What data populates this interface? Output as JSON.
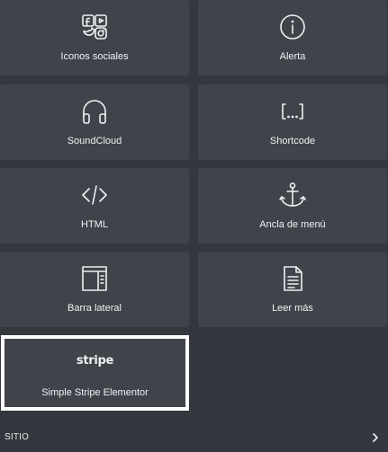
{
  "widgets": [
    {
      "label": "Iconos sociales",
      "icon": "social-icons-icon"
    },
    {
      "label": "Alerta",
      "icon": "info-circle-icon"
    },
    {
      "label": "SoundCloud",
      "icon": "headphones-icon"
    },
    {
      "label": "Shortcode",
      "icon": "shortcode-brackets-icon"
    },
    {
      "label": "HTML",
      "icon": "code-icon"
    },
    {
      "label": "Ancla de menú",
      "icon": "anchor-icon"
    },
    {
      "label": "Barra lateral",
      "icon": "sidebar-layout-icon"
    },
    {
      "label": "Leer más",
      "icon": "document-icon"
    },
    {
      "label": "Simple Stripe Elementor",
      "icon": "stripe-logo",
      "logo_text": "stripe"
    }
  ],
  "section": {
    "title": "SITIO",
    "chevron": "chevron-right-icon"
  },
  "colors": {
    "background": "#34373d",
    "tile": "#40434a",
    "highlight_border": "#ffffff",
    "text": "#f0f2f4"
  }
}
